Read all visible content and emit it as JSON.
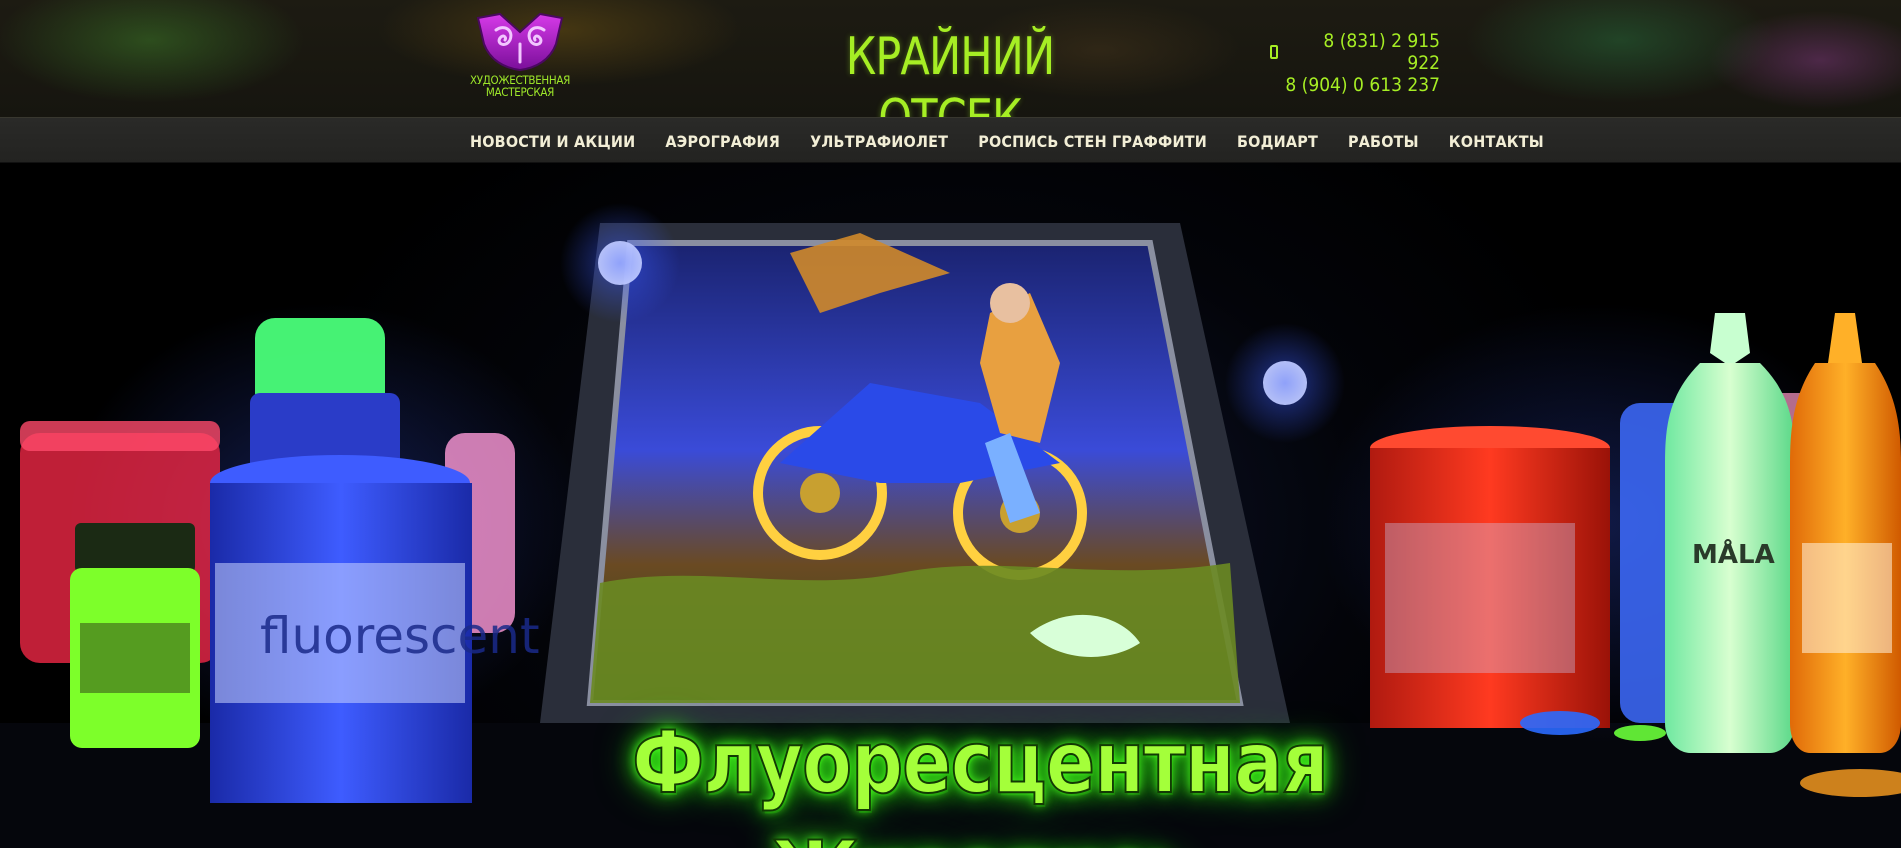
{
  "header": {
    "logo": {
      "line1": "ХУДОЖЕСТВЕННАЯ",
      "line2": "МАСТЕРСКАЯ",
      "icon": "art-workshop-logo"
    },
    "title": "КРАЙНИЙ ОТСЕК",
    "phones": [
      "8 (831) 2 915 922",
      "8 (904) 0 613 237"
    ],
    "phone_icon": "mobile-phone-icon"
  },
  "nav": {
    "items": [
      {
        "label": "НОВОСТИ И АКЦИИ"
      },
      {
        "label": "АЭРОГРАФИЯ"
      },
      {
        "label": "УЛЬТРАФИОЛЕТ"
      },
      {
        "label": "РОСПИСЬ СТЕН ГРАФФИТИ"
      },
      {
        "label": "БОДИАРТ"
      },
      {
        "label": "РАБОТЫ"
      },
      {
        "label": "КОНТАКТЫ"
      }
    ]
  },
  "hero": {
    "caption": "Флуоресцентная Живопись",
    "jar_label": "fluorescent",
    "bottle_label": "MÅLA"
  },
  "colors": {
    "accent_green": "#a6ee24",
    "nav_bg": "#262624",
    "nav_text": "#f2eed6",
    "logo_purple": "#b01fc9"
  }
}
